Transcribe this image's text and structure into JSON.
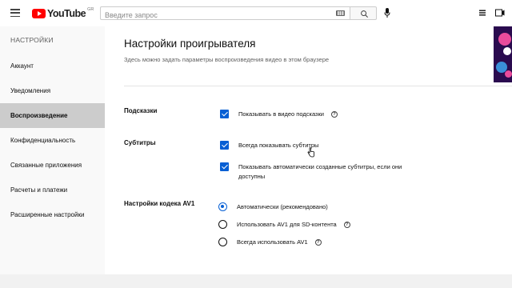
{
  "header": {
    "logo_text": "YouTube",
    "logo_region": "GR",
    "search_placeholder": "Введите запрос"
  },
  "sidebar": {
    "title": "НАСТРОЙКИ",
    "items": [
      {
        "label": "Аккаунт"
      },
      {
        "label": "Уведомления"
      },
      {
        "label": "Воспроизведение",
        "active": true
      },
      {
        "label": "Конфиденциальность"
      },
      {
        "label": "Связанные приложения"
      },
      {
        "label": "Расчеты и платежи"
      },
      {
        "label": "Расширенные настройки"
      }
    ]
  },
  "main": {
    "title": "Настройки проигрывателя",
    "subtitle": "Здесь можно задать параметры воспроизведения видео в этом браузере",
    "sections": {
      "hints": {
        "label": "Подсказки",
        "option": "Показывать в видео подсказки",
        "checked": true
      },
      "subtitles": {
        "label": "Субтитры",
        "option1": "Всегда показывать субтитры",
        "option1_checked": true,
        "option2_line1": "Показывать автоматически созданные субтитры, если они",
        "option2_line2": "доступны",
        "option2_checked": true
      },
      "av1": {
        "label": "Настройки кодека AV1",
        "options": [
          {
            "label": "Автоматически (рекомендовано)",
            "selected": true
          },
          {
            "label": "Использовать AV1 для SD-контента",
            "selected": false
          },
          {
            "label": "Всегда использовать AV1",
            "selected": false
          }
        ]
      }
    },
    "help_glyph": "?"
  },
  "colors": {
    "accent": "#065fd4",
    "logo_red": "#ff0000",
    "active_item_bg": "#cccccc"
  }
}
